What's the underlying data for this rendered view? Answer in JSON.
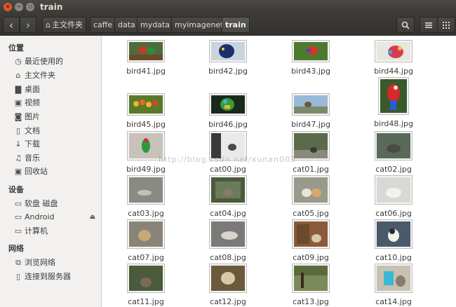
{
  "window": {
    "title": "train"
  },
  "toolbar": {
    "back_icon": "chevron-left-icon",
    "forward_icon": "chevron-right-icon",
    "breadcrumbs": [
      "主文件夹",
      "caffe",
      "data",
      "mydata",
      "myimagenet",
      "train"
    ],
    "active_crumb": "train"
  },
  "sidebar": {
    "section_places": "位置",
    "places": [
      {
        "label": "最近使用的",
        "icon": "clock-icon"
      },
      {
        "label": "主文件夹",
        "icon": "home-icon"
      },
      {
        "label": "桌面",
        "icon": "folder-icon"
      },
      {
        "label": "视频",
        "icon": "video-icon"
      },
      {
        "label": "图片",
        "icon": "camera-icon"
      },
      {
        "label": "文档",
        "icon": "document-icon"
      },
      {
        "label": "下载",
        "icon": "download-icon"
      },
      {
        "label": "音乐",
        "icon": "music-icon"
      },
      {
        "label": "回收站",
        "icon": "trash-icon"
      }
    ],
    "section_devices": "设备",
    "devices": [
      {
        "label": "软盘 磁盘",
        "icon": "drive-icon"
      },
      {
        "label": "Android",
        "icon": "drive-icon"
      },
      {
        "label": "计算机",
        "icon": "computer-icon"
      }
    ],
    "section_network": "网络",
    "network": [
      {
        "label": "浏览网络",
        "icon": "network-icon"
      },
      {
        "label": "连接到服务器",
        "icon": "server-icon"
      }
    ]
  },
  "files": [
    "bird41.jpg",
    "bird42.jpg",
    "bird43.jpg",
    "bird44.jpg",
    "bird45.jpg",
    "bird46.jpg",
    "bird47.jpg",
    "bird48.jpg",
    "bird49.jpg",
    "cat00.jpg",
    "cat01.jpg",
    "cat02.jpg",
    "cat03.jpg",
    "cat04.jpg",
    "cat05.jpg",
    "cat06.jpg",
    "cat07.jpg",
    "cat08.jpg",
    "cat09.jpg",
    "cat10.jpg",
    "cat11.jpg",
    "cat12.jpg",
    "cat13.jpg",
    "cat14.jpg"
  ],
  "watermark": "http://blog.csdn.net/xunan003"
}
